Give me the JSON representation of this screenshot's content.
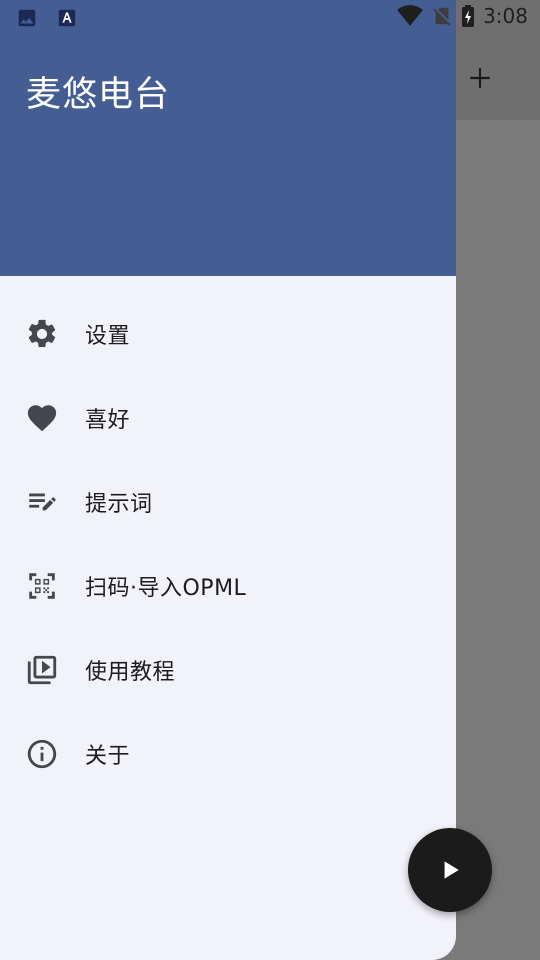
{
  "status_bar": {
    "time": "3:08",
    "left_icons": [
      "image-notification-icon",
      "font-notification-icon"
    ],
    "right_icons": [
      "wifi-icon",
      "no-sim-icon",
      "battery-charging-icon"
    ]
  },
  "background_app": {
    "toolbar_action": "plus-icon"
  },
  "drawer": {
    "title": "麦悠电台",
    "header_color": "#445e94",
    "items": [
      {
        "label": "设置",
        "icon": "gear-icon"
      },
      {
        "label": "喜好",
        "icon": "heart-icon"
      },
      {
        "label": "提示词",
        "icon": "edit-note-icon"
      },
      {
        "label": "扫码·导入OPML",
        "icon": "qr-code-scan-icon"
      },
      {
        "label": "使用教程",
        "icon": "video-library-icon"
      },
      {
        "label": "关于",
        "icon": "info-icon"
      }
    ]
  },
  "fab": {
    "icon": "play-icon"
  }
}
